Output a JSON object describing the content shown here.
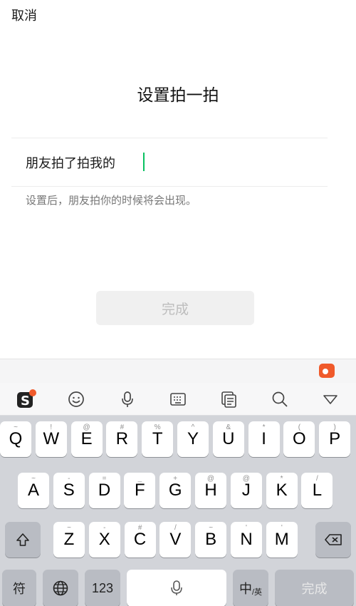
{
  "header": {
    "cancel": "取消",
    "title": "设置拍一拍"
  },
  "form": {
    "prefix": "朋友拍了拍我的",
    "input_value": "",
    "hint": "设置后，朋友拍你的时候将会出现。",
    "done": "完成"
  },
  "keyboard": {
    "toolbar": [
      "sogou-logo-icon",
      "emoji-icon",
      "mic-icon",
      "keyboard-icon",
      "clipboard-icon",
      "search-icon",
      "collapse-icon"
    ],
    "row1": [
      {
        "k": "Q",
        "s": "~"
      },
      {
        "k": "W",
        "s": "!"
      },
      {
        "k": "E",
        "s": "@"
      },
      {
        "k": "R",
        "s": "#"
      },
      {
        "k": "T",
        "s": "%"
      },
      {
        "k": "Y",
        "s": "^"
      },
      {
        "k": "U",
        "s": "&"
      },
      {
        "k": "I",
        "s": "*"
      },
      {
        "k": "O",
        "s": "("
      },
      {
        "k": "P",
        "s": ")"
      }
    ],
    "row2": [
      {
        "k": "A",
        "s": "~"
      },
      {
        "k": "S",
        "s": "-"
      },
      {
        "k": "D",
        "s": "="
      },
      {
        "k": "F",
        "s": "_"
      },
      {
        "k": "G",
        "s": "+"
      },
      {
        "k": "H",
        "s": "@"
      },
      {
        "k": "J",
        "s": "@"
      },
      {
        "k": "K",
        "s": "*"
      },
      {
        "k": "L",
        "s": "/"
      }
    ],
    "row3": [
      {
        "k": "Z",
        "s": "~"
      },
      {
        "k": "X",
        "s": "-"
      },
      {
        "k": "C",
        "s": "#"
      },
      {
        "k": "V",
        "s": "/"
      },
      {
        "k": "B",
        "s": "~"
      },
      {
        "k": "N",
        "s": "'"
      },
      {
        "k": "M",
        "s": "'"
      }
    ],
    "bottom": {
      "fu": "符",
      "num": "123",
      "zh": "中",
      "zh_sub": "/英",
      "done": "完成"
    }
  }
}
